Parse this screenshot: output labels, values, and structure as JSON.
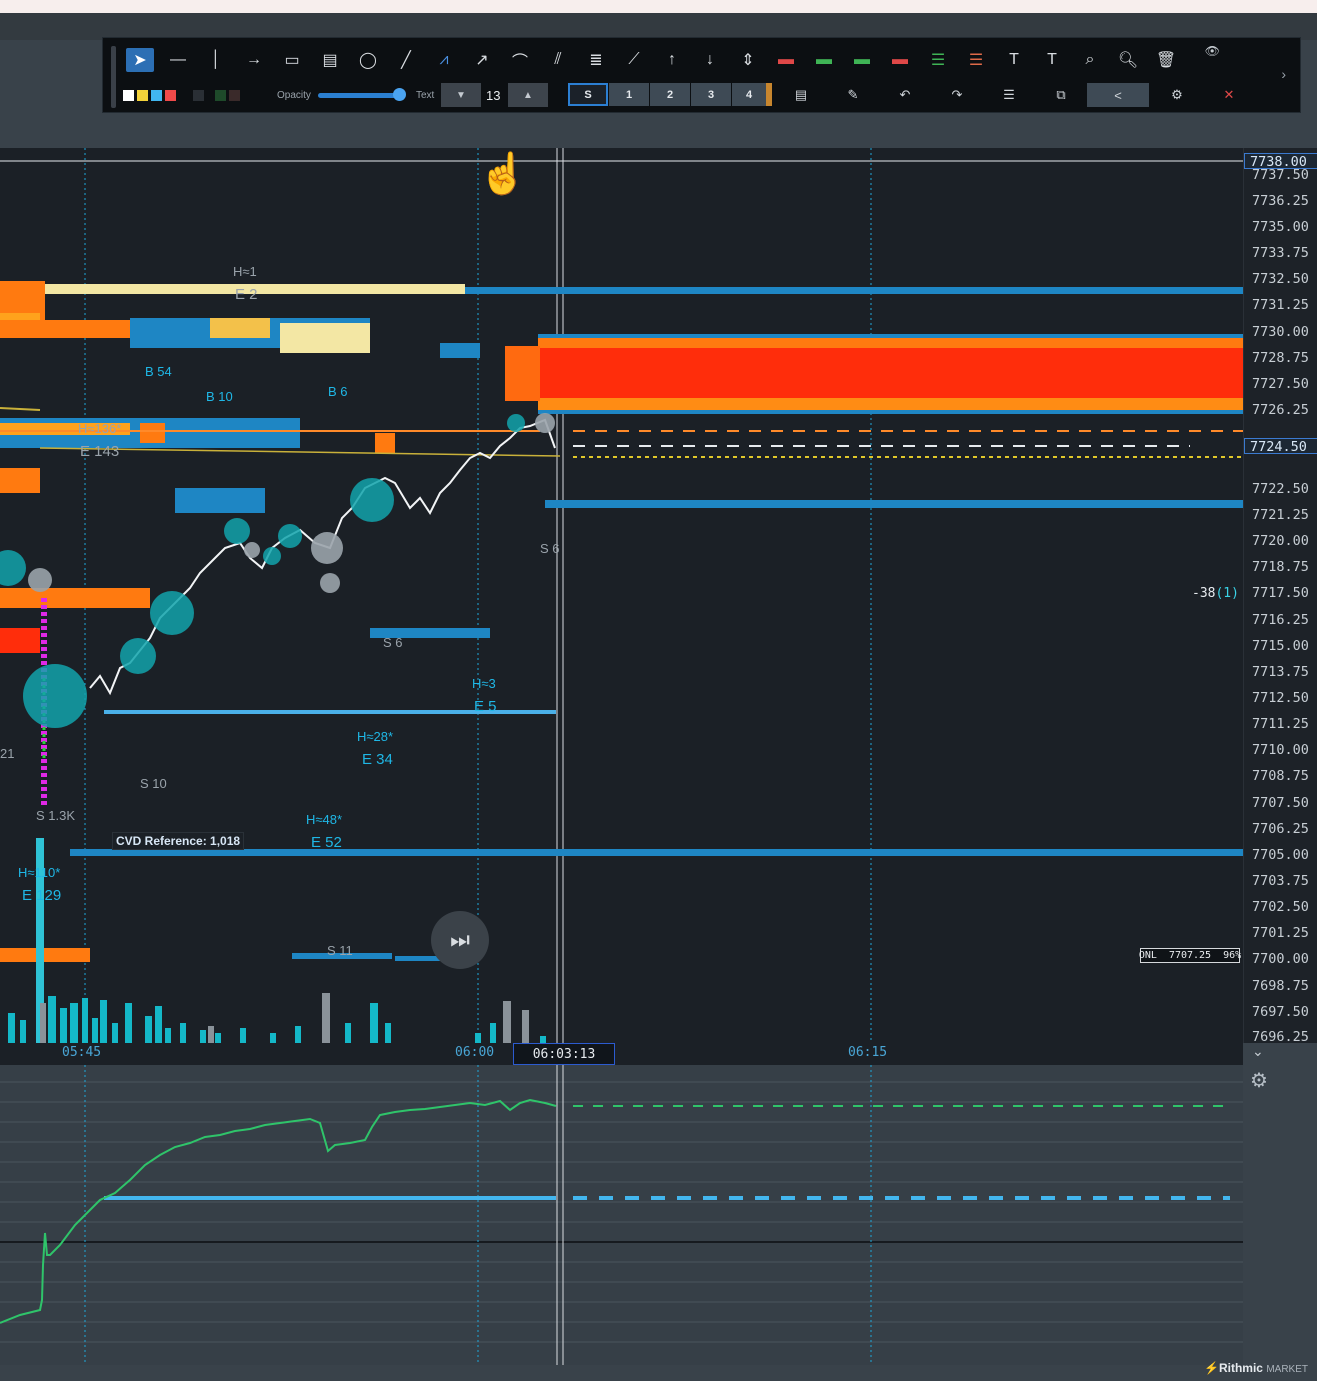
{
  "toolbar": {
    "opacity_label": "Opacity",
    "text_label": "Text",
    "text_size": "13",
    "segments": [
      "S",
      "1",
      "2",
      "3",
      "4"
    ]
  },
  "price_axis": {
    "current_price": "7738.00",
    "highlight_price": "7724.50",
    "ticks": [
      "7737.50",
      "7736.25",
      "7735.00",
      "7733.75",
      "7732.50",
      "7731.25",
      "7730.00",
      "7728.75",
      "7727.50",
      "7726.25",
      "7722.50",
      "7721.25",
      "7720.00",
      "7718.75",
      "7717.50",
      "7716.25",
      "7715.00",
      "7713.75",
      "7712.50",
      "7711.25",
      "7710.00",
      "7708.75",
      "7707.50",
      "7706.25",
      "7705.00",
      "7703.75",
      "7702.50",
      "7701.25",
      "7700.00",
      "7698.75",
      "7697.50",
      "7696.25"
    ]
  },
  "time_axis": {
    "labels": [
      "05:45",
      "06:00",
      "06:15"
    ],
    "cursor_time": "06:03:13"
  },
  "annotations": {
    "h1": "H≈1",
    "e2": "E 2",
    "b54": "B 54",
    "b10": "B 10",
    "b6": "B 6",
    "h136": "H≈136*",
    "e143": "E 143",
    "s6a": "S 6",
    "s6b": "S 6",
    "h3": "H≈3",
    "e5": "E 5",
    "h28": "H≈28*",
    "e34": "E 34",
    "h48": "H≈48*",
    "e52": "E 52",
    "s10": "S 10",
    "s11": "S 11",
    "s13k": "S 1.3K",
    "h110": "H≈110*",
    "e129": "E 129",
    "n21": "21",
    "cvd_reference": "CVD Reference: 1,018",
    "onl": "ONL  7707.25  96%",
    "delta_value": "-38",
    "delta_count": "(1)"
  },
  "branding": {
    "name": "Rithmic",
    "suffix": "MARKET"
  }
}
